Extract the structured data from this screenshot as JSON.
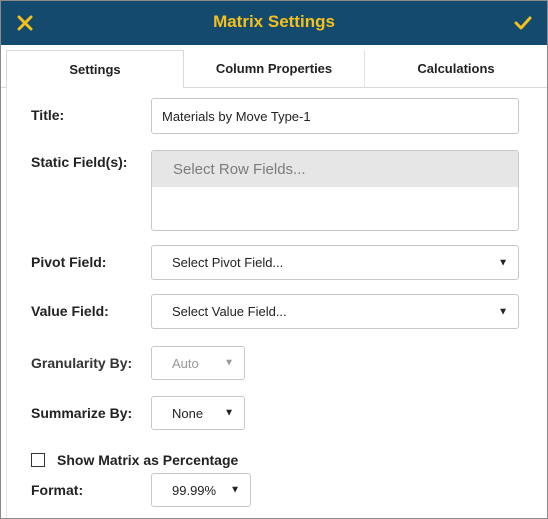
{
  "header": {
    "title": "Matrix Settings",
    "close_icon": "close-icon",
    "confirm_icon": "check-icon",
    "bg_color": "#134a6e",
    "accent_color": "#f4c01e"
  },
  "tabs": [
    {
      "label": "Settings",
      "active": true
    },
    {
      "label": "Column Properties",
      "active": false
    },
    {
      "label": "Calculations",
      "active": false
    }
  ],
  "form": {
    "title_label": "Title:",
    "title_value": "Materials by Move Type-1",
    "static_fields_label": "Static Field(s):",
    "static_fields_placeholder": "Select Row Fields...",
    "pivot_label": "Pivot Field:",
    "pivot_value": "Select Pivot Field...",
    "value_label": "Value Field:",
    "value_value": "Select Value Field...",
    "granularity_label": "Granularity By:",
    "granularity_value": "Auto",
    "summarize_label": "Summarize By:",
    "summarize_value": "None",
    "percentage_label": "Show Matrix as Percentage",
    "percentage_checked": false,
    "format_label": "Format:",
    "format_value": "99.99%",
    "caret_glyph": "▼"
  }
}
